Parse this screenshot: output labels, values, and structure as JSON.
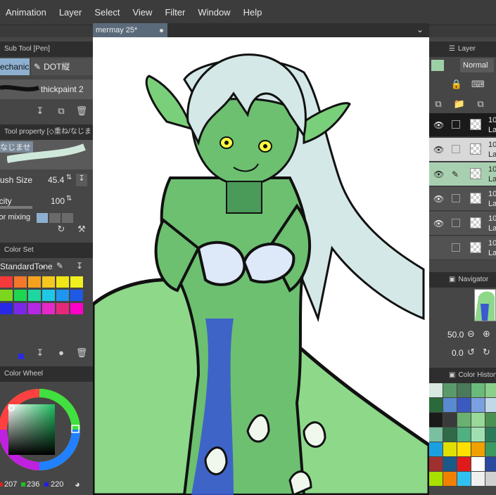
{
  "menu": [
    "Animation",
    "Layer",
    "Select",
    "View",
    "Filter",
    "Window",
    "Help"
  ],
  "document_tab": "mermay 25*",
  "sub_tool": {
    "header": "Sub Tool [Pen]",
    "tab_active": "Mechanic",
    "tab_other": "DOT縦",
    "brush_name": "thickpaint 2"
  },
  "tool_property": {
    "header": "Tool property [◇重ね/なじま",
    "mode_label": "なじませ",
    "brush_size_label": "Brush Size",
    "brush_size_value": "45.4",
    "opacity_label": "Opacity",
    "opacity_value": "100",
    "color_mixing_label": "Color mixing"
  },
  "color_set": {
    "header": "Color Set",
    "set_name": "StandardTone",
    "colors": [
      "#f43a3a",
      "#f4782a",
      "#f4a21e",
      "#f4c81e",
      "#f0e616",
      "#f0f01e",
      "#7cd61e",
      "#1ed650",
      "#1ed6a0",
      "#1ec8e6",
      "#1e96f0",
      "#1e5ae6",
      "#2828e6",
      "#7a28e6",
      "#b428e6",
      "#e628c8",
      "#e6287a",
      "#ff00c8"
    ]
  },
  "color_wheel": {
    "header": "Color Wheel",
    "r": "207",
    "g": "236",
    "b": "220"
  },
  "layer_panel": {
    "header": "Layer",
    "blend_mode": "Normal",
    "rows": [
      {
        "num": "10",
        "name": "La"
      },
      {
        "num": "10",
        "name": "La"
      },
      {
        "num": "10",
        "name": "La"
      },
      {
        "num": "10",
        "name": "La"
      },
      {
        "num": "10",
        "name": "La"
      },
      {
        "num": "10",
        "name": "La"
      }
    ]
  },
  "navigator": {
    "header": "Navigator",
    "zoom": "50.0",
    "rotation": "0.0"
  },
  "color_history": {
    "header": "Color History",
    "colors": [
      "#d8e8e0",
      "#5a9a6a",
      "#4a7a5a",
      "#6aba7a",
      "#8ad08a",
      "#2a6a3a",
      "#5a8ad0",
      "#3a5ac0",
      "#7aa0e0",
      "#c0d8e8",
      "#1a1a1a",
      "#3a3a3a",
      "#6ab070",
      "#98d898",
      "#4a9050",
      "#7ac0a0",
      "#306a48",
      "#50b080",
      "#a0e0b0",
      "#2a7a5a",
      "#1aa0e0",
      "#e0e000",
      "#ffe000",
      "#f0a000",
      "#3a9a60",
      "#a03030",
      "#1a5a8a",
      "#e01a1a",
      "#ffffff",
      "#2a4aa0",
      "#a8e000",
      "#f08000",
      "#30c0f0",
      "#f0f0f0",
      "#d0d0d0"
    ]
  }
}
